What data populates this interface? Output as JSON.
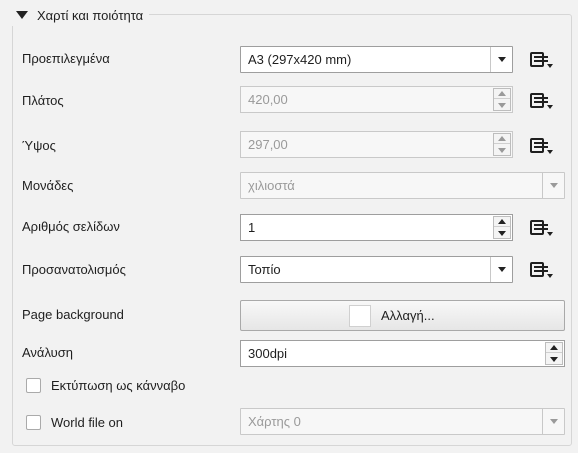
{
  "group": {
    "title": "Χαρτί και ποιότητα"
  },
  "rows": {
    "presets": {
      "label": "Προεπιλεγμένα",
      "value": "A3 (297x420 mm)"
    },
    "width": {
      "label": "Πλάτος",
      "value": "420,00"
    },
    "height": {
      "label": "Ύψος",
      "value": "297,00"
    },
    "units": {
      "label": "Μονάδες",
      "value": "χιλιοστά"
    },
    "pages": {
      "label": "Αριθμός σελίδων",
      "value": "1"
    },
    "orientation": {
      "label": "Προσανατολισμός",
      "value": "Τοπίο"
    },
    "background": {
      "label": "Page background",
      "button_label": "Αλλαγή...",
      "swatch_color": "#ffffff"
    },
    "resolution": {
      "label": "Ανάλυση",
      "value": "300dpi"
    },
    "print_raster": {
      "label": "Εκτύπωση ως κάνναβο",
      "checked": false
    },
    "world_file": {
      "label": "World file on",
      "checked": false,
      "map_value": "Χάρτης 0"
    }
  },
  "icons": {
    "data_defined": "data-defined-override-icon",
    "collapse": "collapse-triangle-icon"
  }
}
